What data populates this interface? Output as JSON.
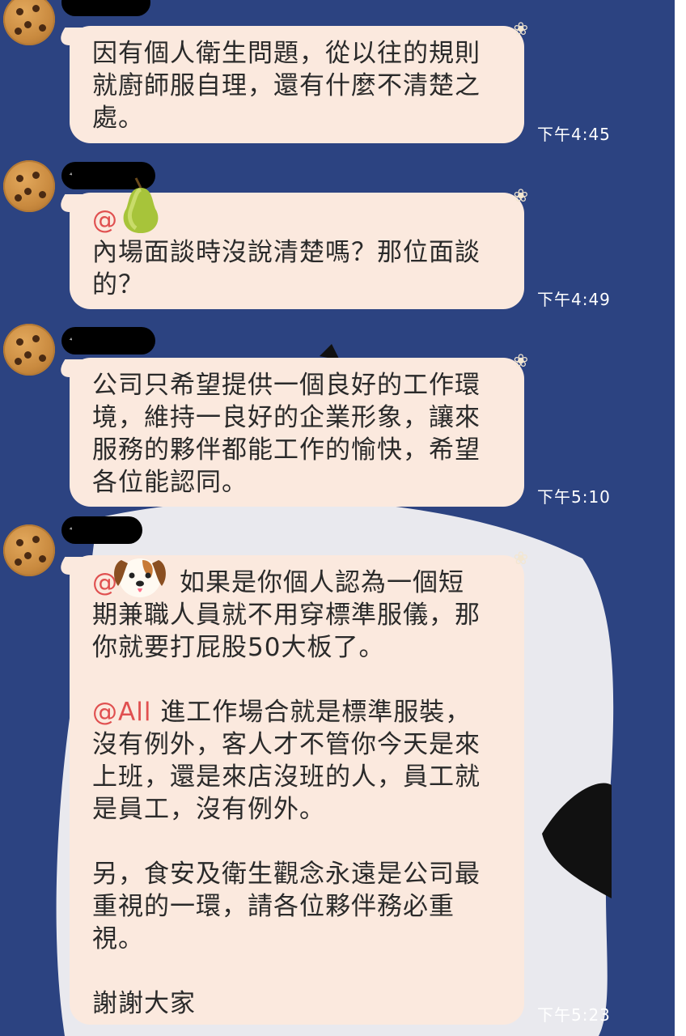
{
  "messages": [
    {
      "time": "下午4:45",
      "lines": [
        "因有個人衛生問題，從以往的規則",
        "就廚師服自理，還有什麼不清楚之",
        "處。"
      ]
    },
    {
      "time": "下午4:49",
      "mention": "@",
      "lines": [
        "內場面談時沒說清楚嗎？那位面談",
        "的？"
      ]
    },
    {
      "time": "下午5:10",
      "lines": [
        "公司只希望提供一個良好的工作環",
        "境，維持一良好的企業形象，讓來",
        "服務的夥伴都能工作的愉快，希望",
        "各位能認同。"
      ]
    },
    {
      "time": "下午5:23",
      "mention": "@",
      "first_line": "如果是你個人認為一個短",
      "lines_a": [
        "期兼職人員就不用穿標準服儀，那",
        "你就要打屁股50大板了。"
      ],
      "mention_all": "@All",
      "all_line": "進工作場合就是標準服裝，",
      "lines_b": [
        "沒有例外，客人才不管你今天是來",
        "上班，還是來店沒班的人，員工就",
        "是員工，沒有例外。"
      ],
      "lines_c": [
        "另，食安及衛生觀念永遠是公司最",
        "重視的一環，請各位夥伴務必重",
        "視。"
      ],
      "closing": "謝謝大家"
    }
  ],
  "icons": {
    "avatar": "cookie-avatar",
    "flower": "flower-icon",
    "pear": "pear-emoji",
    "dog": "dog-emoji"
  },
  "colors": {
    "background": "#2c4381",
    "bubble": "#fbe9de",
    "mention": "#e05050",
    "time": "#ffffff"
  }
}
